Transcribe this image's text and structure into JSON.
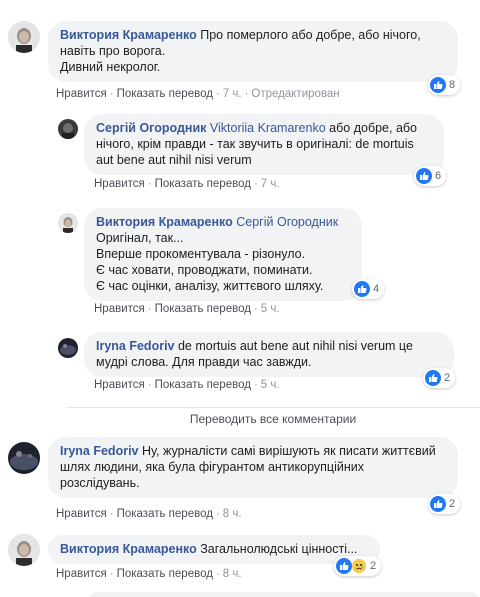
{
  "comments": [
    {
      "author": "Виктория Крамаренко",
      "mention": "",
      "lines": [
        "Про померлого або добре, або нічого,",
        "навіть про ворога.",
        "Дивний некролог."
      ],
      "actions": {
        "like": "Нравится",
        "translate": "Показать перевод",
        "time": "7 ч.",
        "edited": "Отредактирован"
      },
      "reactions": {
        "icons": [
          "like-icon"
        ],
        "count": "8"
      }
    },
    {
      "author": "Сергій Огородник",
      "mention": "Viktoriia Kramarenko",
      "lines": [
        "або добре, або",
        "нічого, крім правди - так звучить в оригіналі: de mortuis",
        "aut bene aut nihil nisi verum"
      ],
      "actions": {
        "like": "Нравится",
        "translate": "Показать перевод",
        "time": "7 ч."
      },
      "reactions": {
        "icons": [
          "like-icon"
        ],
        "count": "6"
      }
    },
    {
      "author": "Виктория Крамаренко",
      "mention": "Сергій Огородник",
      "lines": [
        "Оригінал, так...",
        "Вперше прокоментувала - різонуло.",
        "Є час ховати, проводжати, поминати.",
        "Є час оцінки, аналізу, життєвого шляху."
      ],
      "actions": {
        "like": "Нравится",
        "translate": "Показать перевод",
        "time": "5 ч."
      },
      "reactions": {
        "icons": [
          "like-icon"
        ],
        "count": "4"
      }
    },
    {
      "author": "Iryna Fedoriv",
      "mention": "",
      "lines": [
        "de mortuis aut bene aut nihil nisi verum це",
        "мудрі слова. Для правди час завжди."
      ],
      "actions": {
        "like": "Нравится",
        "translate": "Показать перевод",
        "time": "5 ч."
      },
      "reactions": {
        "icons": [
          "like-icon"
        ],
        "count": "2"
      }
    },
    {
      "author": "Iryna Fedoriv",
      "mention": "",
      "lines": [
        "Ну, журналісти самі вирішують як писати життєвий",
        "шлях людини, яка була фігурантом антикорупційних",
        "розслідувань."
      ],
      "actions": {
        "like": "Нравится",
        "translate": "Показать перевод",
        "time": "8 ч."
      },
      "reactions": {
        "icons": [
          "like-icon"
        ],
        "count": "2"
      }
    },
    {
      "author": "Виктория Крамаренко",
      "mention": "",
      "lines": [
        "Загальнолюдські цінності..."
      ],
      "actions": {
        "like": "Нравится",
        "translate": "Показать перевод",
        "time": "8 ч."
      },
      "reactions": {
        "icons": [
          "like-icon",
          "sad-icon"
        ],
        "count": "2"
      }
    }
  ],
  "translate_all": "Переводить все комментарии",
  "colors": {
    "author": "#385898",
    "bubble": "#f2f3f5",
    "like": "#2078f4",
    "meta": "#90949c"
  }
}
